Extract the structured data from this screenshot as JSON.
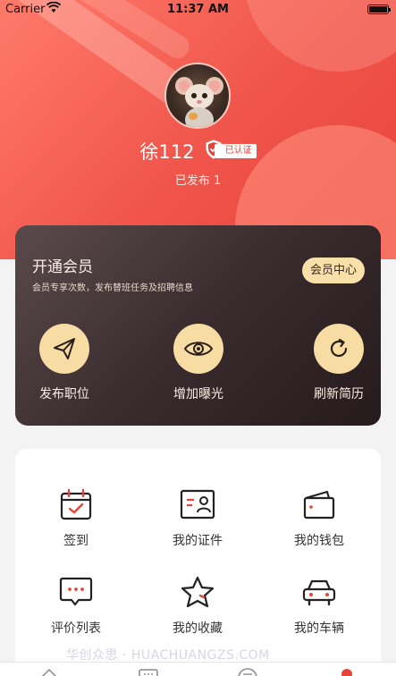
{
  "status_bar": {
    "carrier": "Carrier",
    "time": "11:37 AM"
  },
  "profile": {
    "username": "徐112",
    "verified_label": "已认证",
    "published_label": "已发布",
    "published_count": "1"
  },
  "membership": {
    "title": "开通会员",
    "subtitle": "会员专享次数，发布替班任务及招聘信息",
    "center_button": "会员中心",
    "actions": [
      {
        "label": "发布职位",
        "icon": "paper-plane-icon"
      },
      {
        "label": "增加曝光",
        "icon": "eye-icon"
      },
      {
        "label": "刷新简历",
        "icon": "refresh-icon"
      }
    ]
  },
  "features": [
    {
      "label": "签到",
      "icon": "calendar-check-icon"
    },
    {
      "label": "我的证件",
      "icon": "id-card-icon"
    },
    {
      "label": "我的钱包",
      "icon": "wallet-icon"
    },
    {
      "label": "评价列表",
      "icon": "comment-icon"
    },
    {
      "label": "我的收藏",
      "icon": "star-icon"
    },
    {
      "label": "我的车辆",
      "icon": "car-icon"
    }
  ],
  "watermark": "华创众思 · HUACHUANGZS.COM",
  "colors": {
    "brand_red": "#e8433b",
    "gold": "#f7dca4",
    "dark_card": "#3a2c2e"
  }
}
